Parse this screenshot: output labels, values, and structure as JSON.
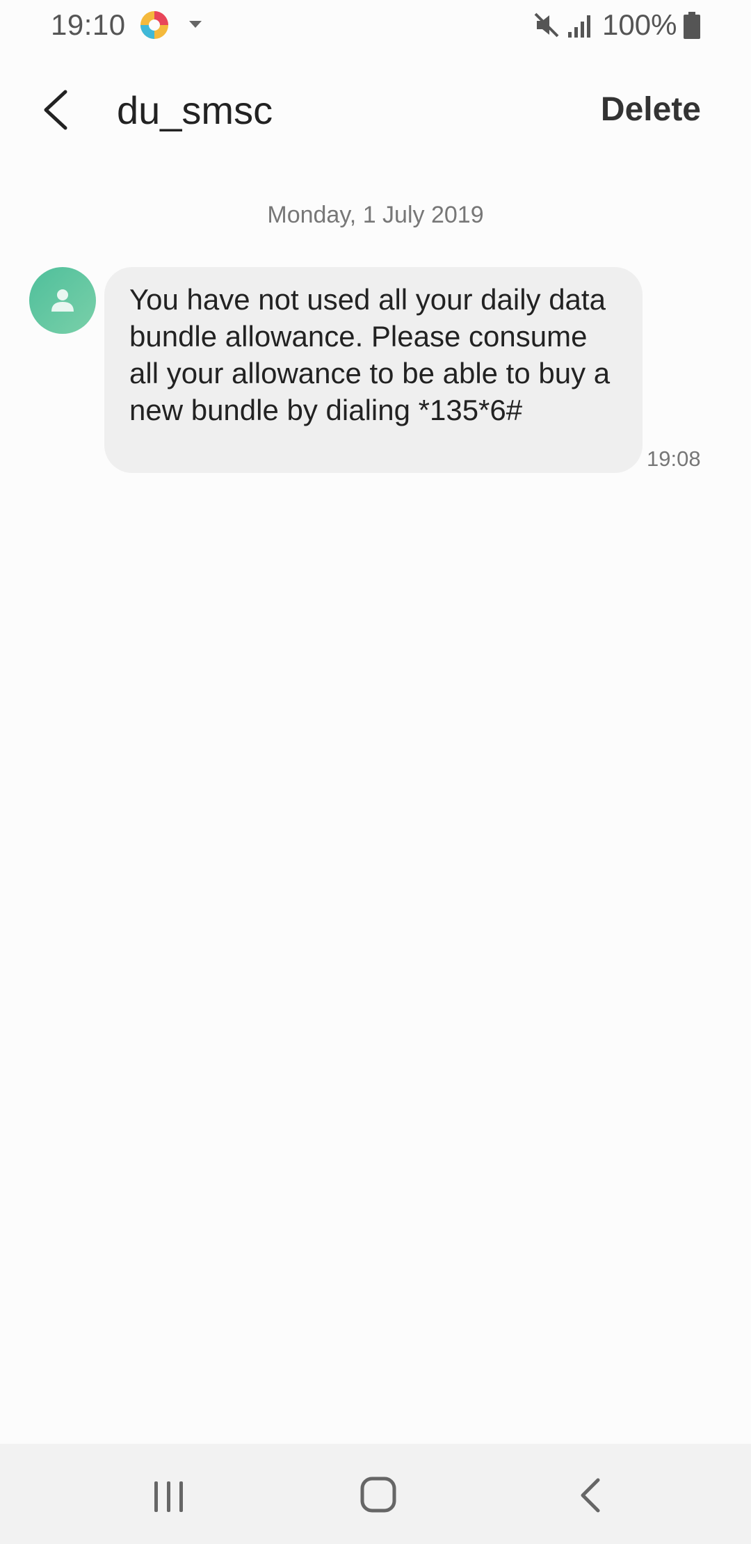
{
  "status_bar": {
    "time": "19:10",
    "battery": "100%",
    "icons": [
      "app-notification-icon",
      "dropdown-arrow-icon",
      "mute-icon",
      "signal-icon",
      "battery-icon"
    ]
  },
  "header": {
    "title": "du_smsc",
    "delete_label": "Delete",
    "back_icon": "back-arrow-icon"
  },
  "conversation": {
    "date": "Monday, 1 July 2019",
    "messages": [
      {
        "text": "You have not used all your daily data bundle allowance. Please consume all your allowance to be able to buy a new bundle by dialing *135*6#",
        "time": "19:08",
        "avatar_icon": "person-icon"
      }
    ]
  },
  "nav_bar": {
    "icons": [
      "recents-icon",
      "home-icon",
      "back-icon"
    ]
  },
  "colors": {
    "background": "#fcfcfc",
    "bubble": "#efefef",
    "avatar": "#5cc49f",
    "nav_bar": "#f2f2f2"
  }
}
